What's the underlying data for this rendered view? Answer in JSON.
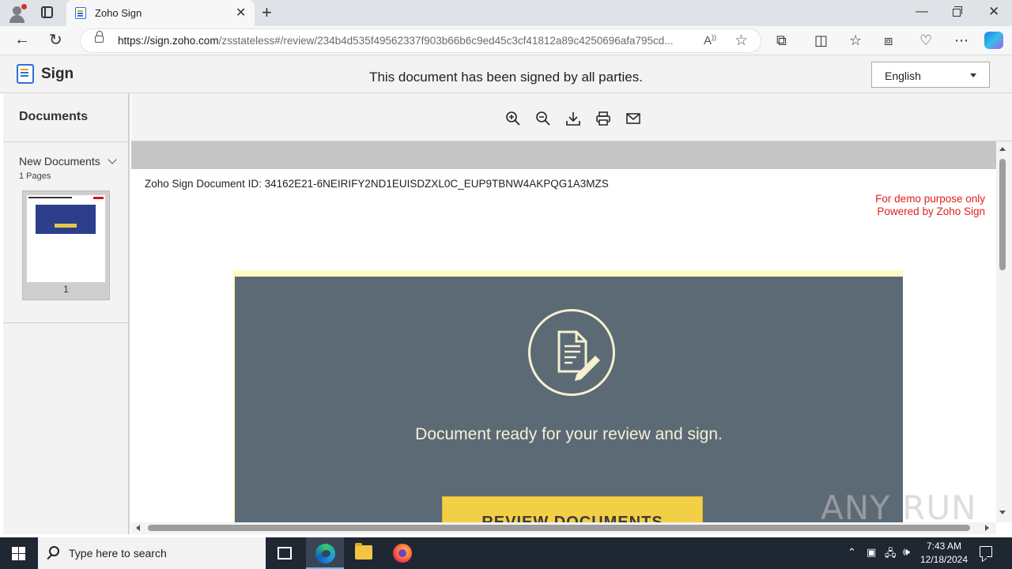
{
  "browser": {
    "tab_title": "Zoho Sign",
    "url_host": "https://sign.zoho.com",
    "url_path": "/zsstateless#/review/234b4d535f49562337f903b66b6c9ed45c3cf41812a89c4250696afa795cd...",
    "colors": {
      "tabbar": "#dfe3e7",
      "accent": "#2f6fdc"
    }
  },
  "app": {
    "logo_text": "Sign",
    "status_message": "This document has been signed by all parties.",
    "language": "English"
  },
  "sidebar": {
    "title": "Documents",
    "document_name": "New Documents",
    "pages_label": "1 Pages",
    "thumbnail_page_number": "1"
  },
  "toolbar": {
    "icons": [
      "zoom-in-icon",
      "zoom-out-icon",
      "download-icon",
      "print-icon",
      "email-icon"
    ]
  },
  "document": {
    "id_text": "Zoho Sign Document ID: 34162E21-6NEIRIFY2ND1EUISDZXL0C_EUP9TBNW4AKPQG1A3MZS",
    "demo_line1": "For demo purpose only",
    "demo_line2": "Powered by Zoho Sign",
    "banner_text": "Document ready for your review and sign.",
    "button_text": "REVIEW DOCUMENTS",
    "colors": {
      "banner": "#5c6a76",
      "button": "#f2cf45",
      "demo": "#e0201b"
    }
  },
  "watermark": {
    "text": "ANY RUN"
  },
  "taskbar": {
    "search_placeholder": "Type here to search",
    "time": "7:43 AM",
    "date": "12/18/2024"
  }
}
